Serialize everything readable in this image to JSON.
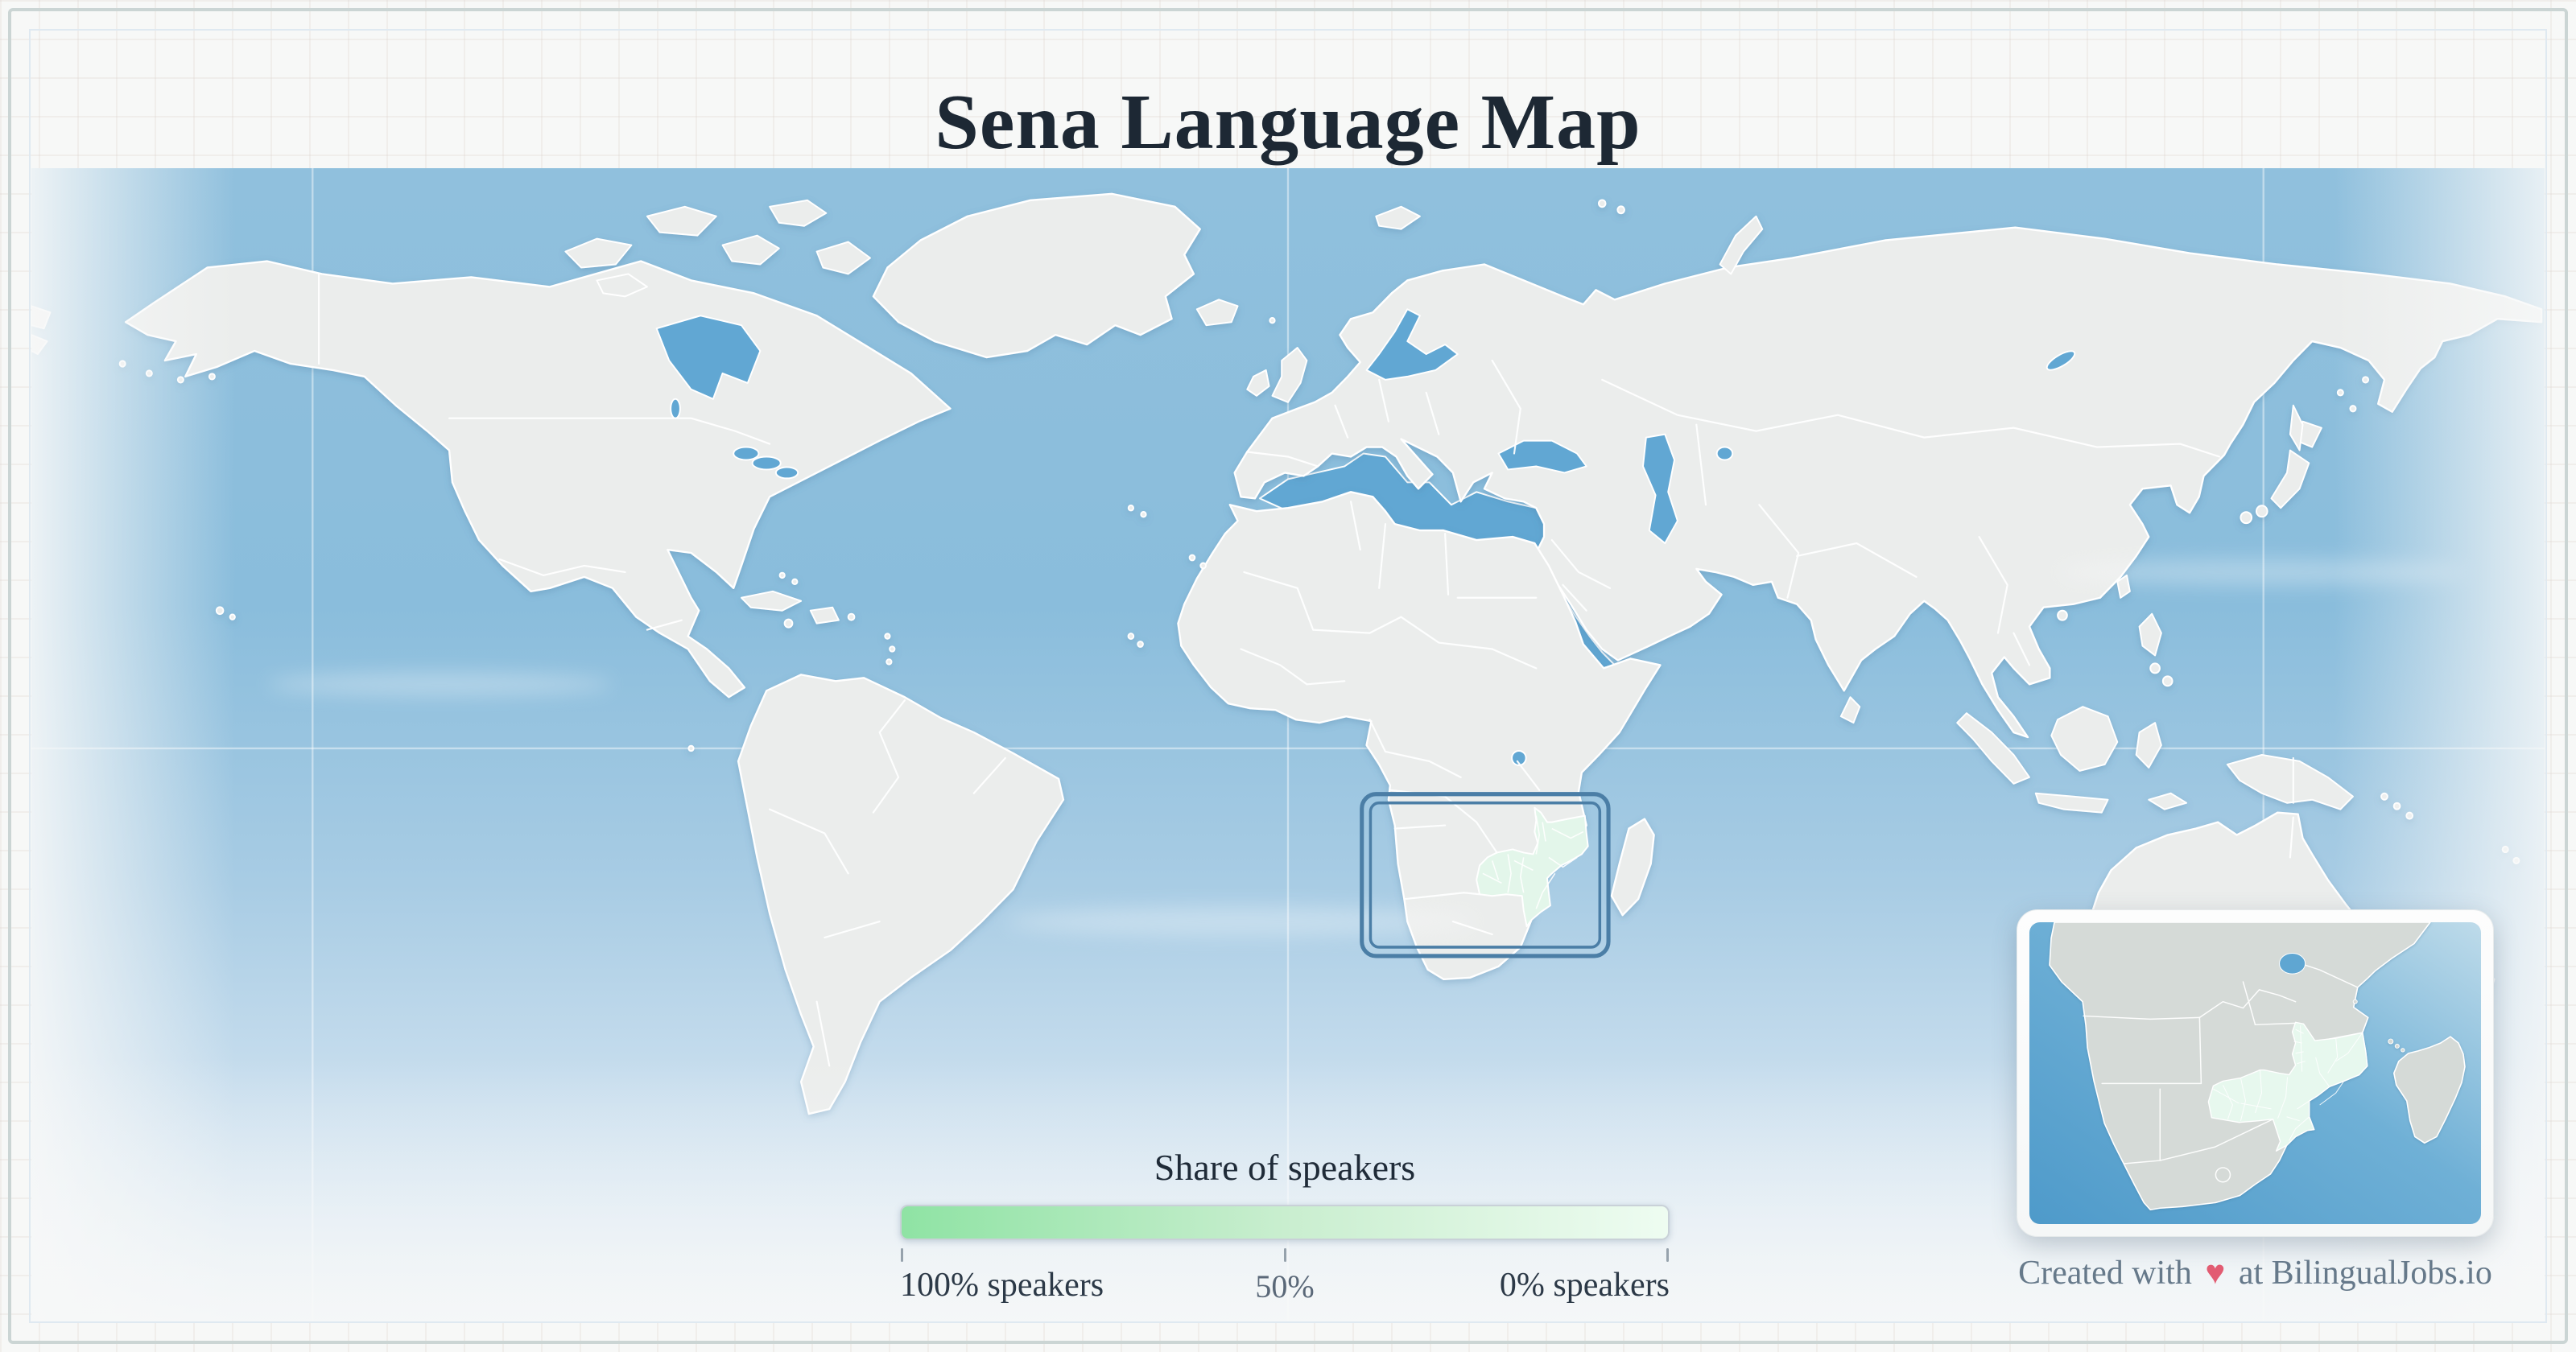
{
  "title": "Sena Language Map",
  "legend": {
    "title": "Share of speakers",
    "label_100": "100% speakers",
    "label_50": "50%",
    "label_0": "0% speakers"
  },
  "attribution": {
    "prefix": "Created with",
    "heart": "♥",
    "suffix": "at BilingualJobs.io"
  },
  "css_vars": {
    "--grad-start": "#8fe3a4",
    "--grad-mid": "#c9eecf",
    "--grad-end": "#eefcf1",
    "--land": "#ebedec",
    "--land-inset": "#d5dad7",
    "--sea": "#61a7d3",
    "--highlight": "#e3f6ea",
    "--highlight-inset": "#e7f8ee",
    "--ocean-top": "#90c0dd",
    "--ocean-bottom": "#e9f1f6",
    "--focus": "#4b7ea6",
    "--heart": "#e25c72"
  }
}
